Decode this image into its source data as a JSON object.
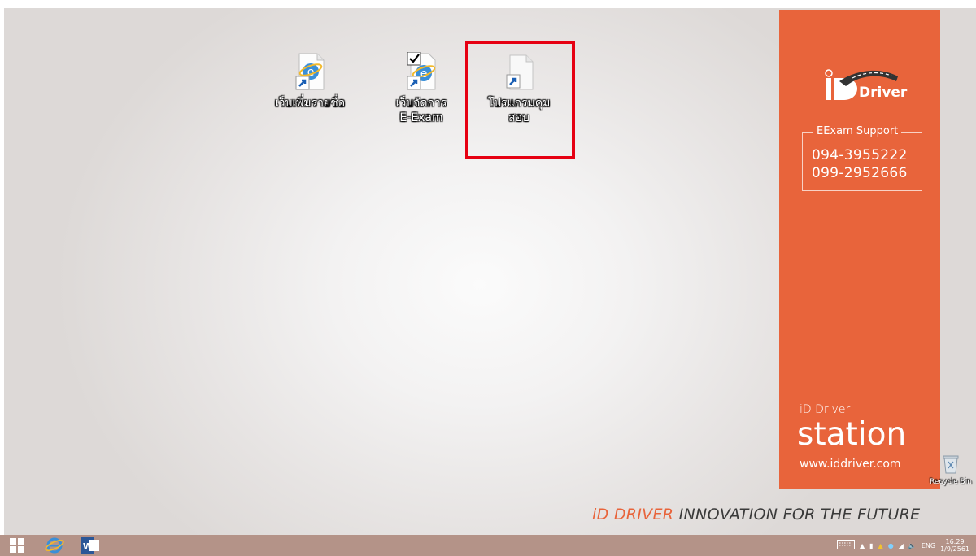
{
  "desktop": {
    "icons": [
      {
        "label": "เว็บเพิ่มรายชื่อ"
      },
      {
        "label_line1": "เว็บจัดการ",
        "label_line2": "E-Exam"
      },
      {
        "label_line1": "โปรแกรมคุม",
        "label_line2": "สอบ"
      }
    ],
    "recycle_bin": {
      "label": "Recycle Bin"
    }
  },
  "panel": {
    "brand_letters": "iD",
    "brand_word": "Driver",
    "support_title": "EExam Support",
    "phones": [
      "094-3955222",
      "099-2952666"
    ],
    "product_small": "iD Driver",
    "product_name": "station",
    "url": "www.iddriver.com",
    "accent_color": "#e8643b"
  },
  "tagline": {
    "highlight": "iD DRIVER",
    "rest": " INNOVATION FOR THE FUTURE"
  },
  "taskbar": {
    "pinned": [
      "windows-start",
      "internet-explorer",
      "microsoft-word"
    ],
    "tray": {
      "lang": "ENG",
      "time": "16:29",
      "date": "1/9/2561"
    }
  }
}
